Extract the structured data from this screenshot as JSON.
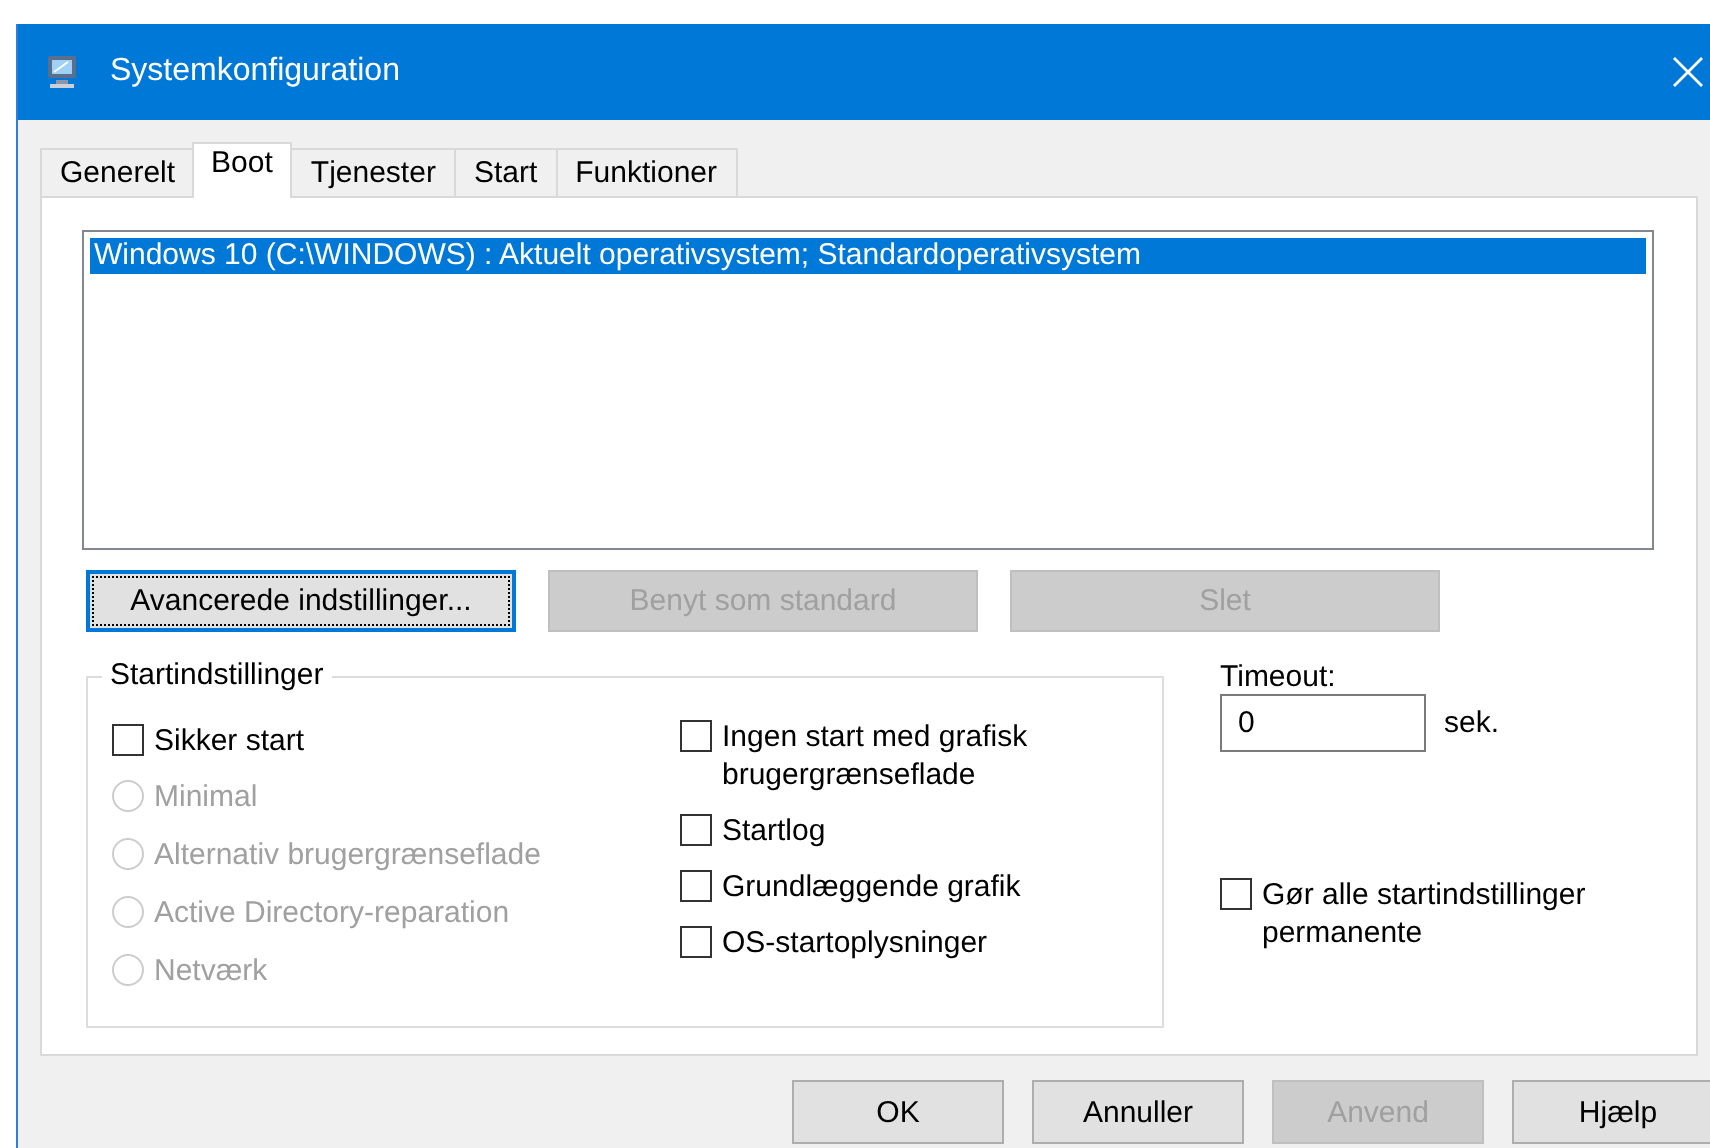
{
  "window": {
    "title": "Systemkonfiguration"
  },
  "tabs": [
    {
      "label": "Generelt",
      "selected": false
    },
    {
      "label": "Boot",
      "selected": true
    },
    {
      "label": "Tjenester",
      "selected": false
    },
    {
      "label": "Start",
      "selected": false
    },
    {
      "label": "Funktioner",
      "selected": false
    }
  ],
  "boot_list": {
    "entries": [
      {
        "text": "Windows 10 (C:\\WINDOWS) : Aktuelt operativsystem; Standardoperativsystem",
        "selected": true
      }
    ]
  },
  "boot_buttons": [
    {
      "label": "Avancerede indstillinger...",
      "disabled": false,
      "focused": true
    },
    {
      "label": "Benyt som standard",
      "disabled": true,
      "focused": false
    },
    {
      "label": "Slet",
      "disabled": true,
      "focused": false
    }
  ],
  "start_options": {
    "title": "Startindstillinger",
    "safe_boot": {
      "label": "Sikker start",
      "checked": false
    },
    "modes": [
      {
        "label": "Minimal",
        "selected": false,
        "disabled": true
      },
      {
        "label": "Alternativ brugergrænseflade",
        "selected": false,
        "disabled": true
      },
      {
        "label": "Active Directory-reparation",
        "selected": false,
        "disabled": true
      },
      {
        "label": "Netværk",
        "selected": false,
        "disabled": true
      }
    ],
    "options": [
      {
        "label": "Ingen start med grafisk brugergrænseflade",
        "checked": false
      },
      {
        "label": "Startlog",
        "checked": false
      },
      {
        "label": "Grundlæggende grafik",
        "checked": false
      },
      {
        "label": "OS-startoplysninger",
        "checked": false
      }
    ]
  },
  "timeout": {
    "label": "Timeout:",
    "value": "0",
    "unit": "sek."
  },
  "make_permanent": {
    "label": "Gør alle startindstillinger permanente",
    "checked": false
  },
  "dialog_buttons": [
    {
      "label": "OK",
      "disabled": false
    },
    {
      "label": "Annuller",
      "disabled": false
    },
    {
      "label": "Anvend",
      "disabled": true
    },
    {
      "label": "Hjælp",
      "disabled": false
    }
  ]
}
